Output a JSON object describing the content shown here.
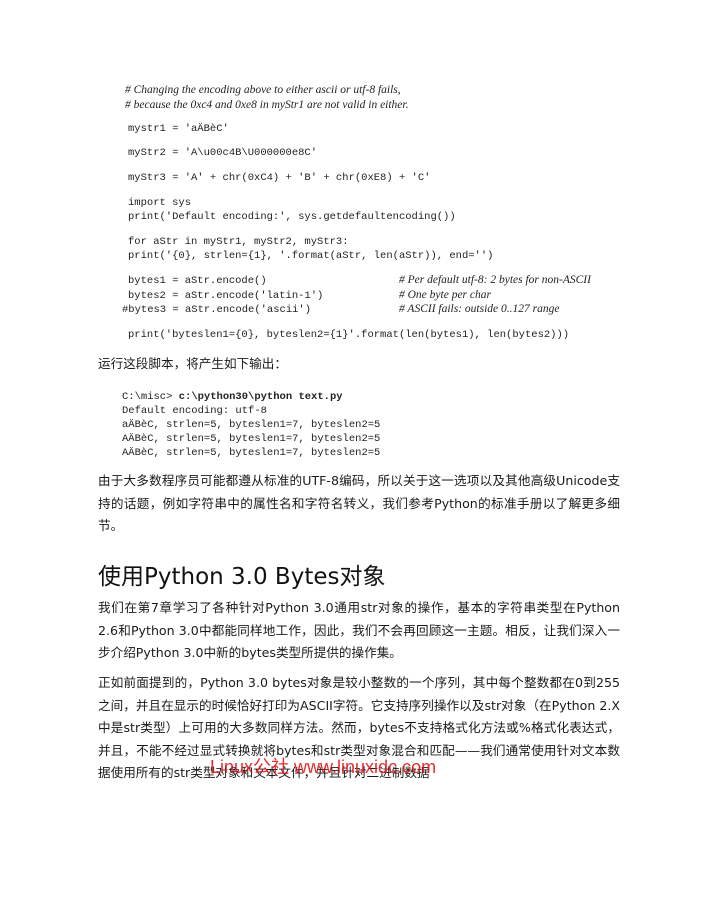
{
  "code_block": {
    "comment1": "# Changing the encoding above to either ascii or utf-8 fails,",
    "comment2": "# because the 0xc4 and 0xe8 in myStr1 are not valid in either.",
    "line_mystr1": "mystr1 = 'aÄBèC'",
    "line_mystr2": "myStr2 = 'A\\u00c4B\\U000000e8C'",
    "line_mystr3": "myStr3 = 'A' + chr(0xC4) + 'B' + chr(0xE8) + 'C'",
    "line_import": "import sys",
    "line_print_enc": "print('Default encoding:', sys.getdefaultencoding())",
    "line_for": "for aStr in myStr1, myStr2, myStr3:",
    "line_for_print": "print('{0}, strlen={1}, '.format(aStr, len(aStr)), end='')",
    "line_bytes1": "bytes1 = aStr.encode()",
    "line_bytes1_comment": "# Per default utf-8: 2 bytes for non-ASCII",
    "line_bytes2": "bytes2 = aStr.encode('latin-1')",
    "line_bytes2_comment": "# One byte per char",
    "line_bytes3": "#bytes3 = aStr.encode('ascii')",
    "line_bytes3_comment": "# ASCII fails: outside 0..127 range",
    "line_print_bytes": "print('byteslen1={0}, byteslen2={1}'.format(len(bytes1), len(bytes2)))"
  },
  "intro_run": "运行这段脚本，将产生如下输出：",
  "output_block": {
    "prompt": "C:\\misc> ",
    "command": "c:\\python30\\python text.py",
    "line1": "Default encoding: utf-8",
    "line2": "aÄBèC, strlen=5, byteslen1=7, byteslen2=5",
    "line3": "AÄBèC, strlen=5, byteslen1=7, byteslen2=5",
    "line4": "AÄBèC, strlen=5, byteslen1=7, byteslen2=5"
  },
  "para_unicode": "由于大多数程序员可能都遵从标准的UTF-8编码，所以关于这一选项以及其他高级Unicode支持的话题，例如字符串中的属性名和字符名转义，我们参考Python的标准手册以了解更多细节。",
  "heading": "使用Python 3.0 Bytes对象",
  "para_ch7": "我们在第7章学习了各种针对Python 3.0通用str对象的操作，基本的字符串类型在Python 2.6和Python 3.0中都能同样地工作，因此，我们不会再回顾这一主题。相反，让我们深入一步介绍Python 3.0中新的bytes类型所提供的操作集。",
  "para_bytes": "正如前面提到的，Python 3.0 bytes对象是较小整数的一个序列，其中每个整数都在0到255之间，并且在显示的时候恰好打印为ASCII字符。它支持序列操作以及str对象（在Python 2.X中是str类型）上可用的大多数同样方法。然而，bytes不支持格式化方法或%格式化表达式，并且，不能不经过显式转换就将bytes和str类型对象混合和匹配——我们通常使用针对文本数据使用所有的str类型对象和文本文件，并且针对二进制数据",
  "watermark": "Linux公社 www.linuxidc.com"
}
